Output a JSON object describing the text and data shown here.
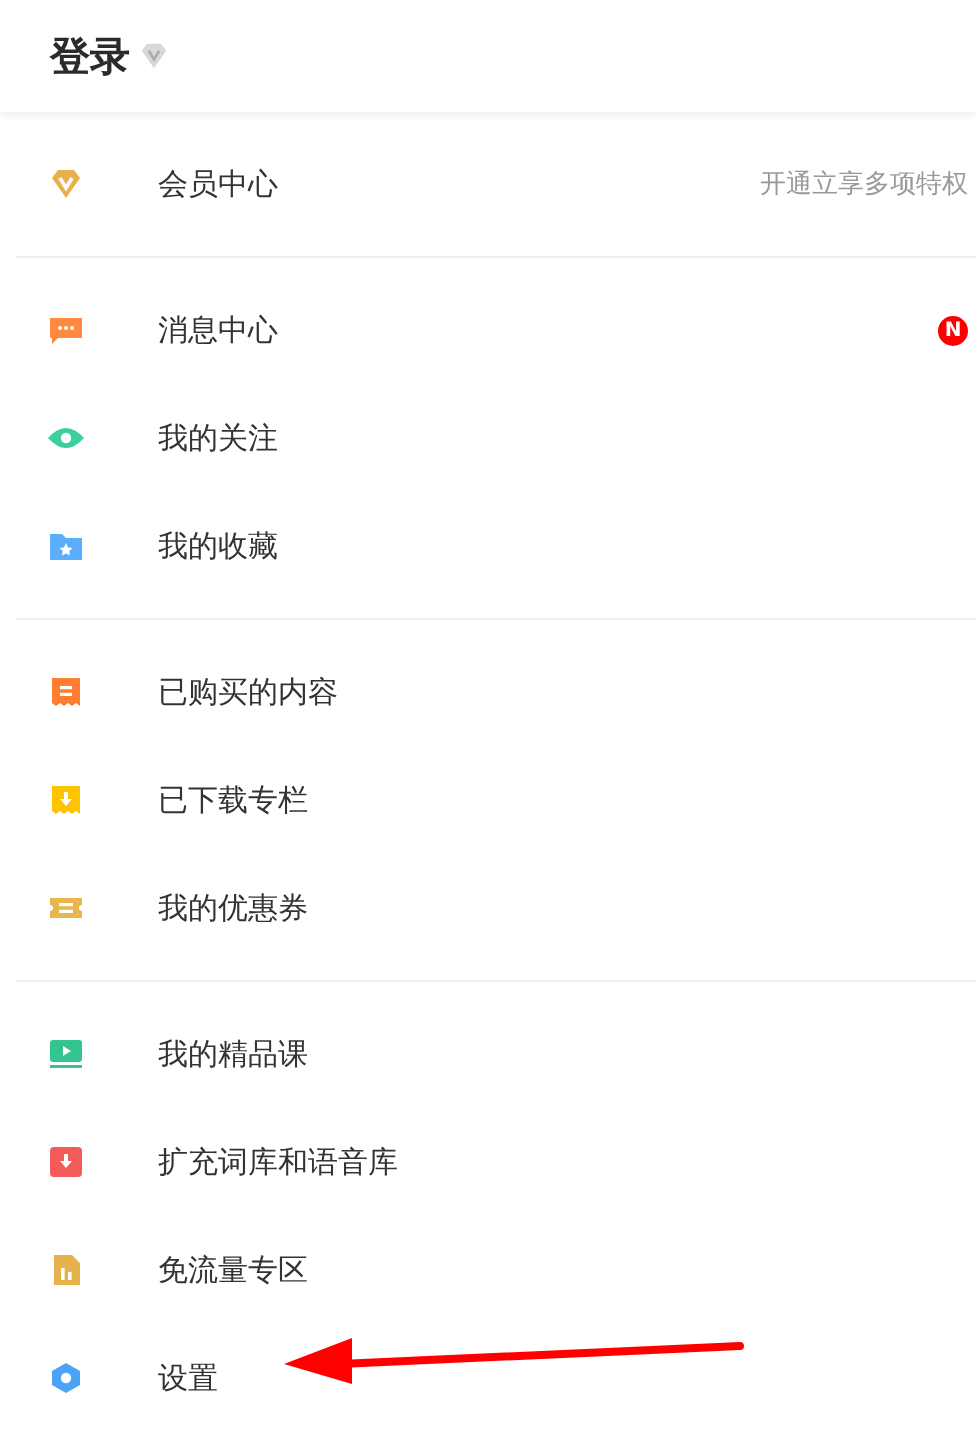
{
  "header": {
    "title": "登录"
  },
  "sections": [
    {
      "items": [
        {
          "label": "会员中心",
          "hint": "开通立享多项特权"
        }
      ]
    },
    {
      "items": [
        {
          "label": "消息中心",
          "badge": "N"
        },
        {
          "label": "我的关注"
        },
        {
          "label": "我的收藏"
        }
      ]
    },
    {
      "items": [
        {
          "label": "已购买的内容"
        },
        {
          "label": "已下载专栏"
        },
        {
          "label": "我的优惠券"
        }
      ]
    },
    {
      "items": [
        {
          "label": "我的精品课"
        },
        {
          "label": "扩充词库和语音库"
        },
        {
          "label": "免流量专区"
        },
        {
          "label": "设置"
        }
      ]
    }
  ]
}
